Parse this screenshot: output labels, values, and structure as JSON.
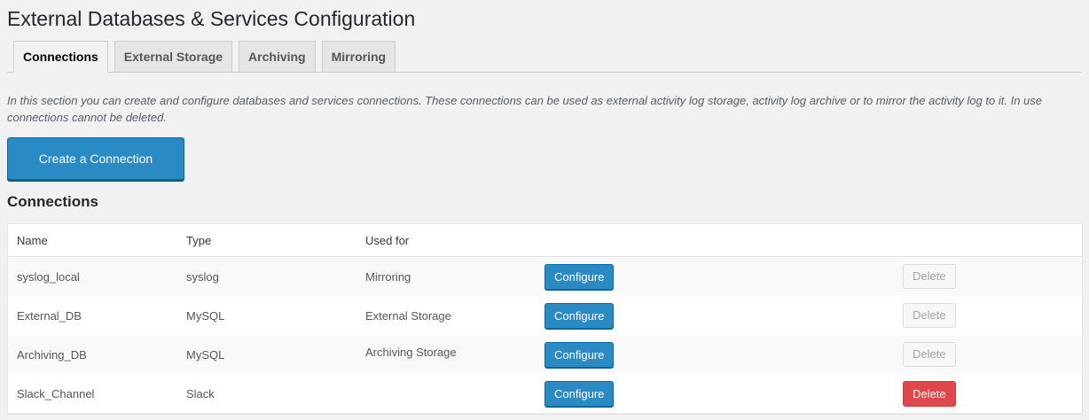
{
  "page": {
    "title": "External Databases & Services Configuration",
    "description": "In this section you can create and configure databases and services connections. These connections can be used as external activity log storage, activity log archive or to mirror the activity log to it. In use connections cannot be deleted."
  },
  "tabs": [
    {
      "label": "Connections",
      "active": true
    },
    {
      "label": "External Storage",
      "active": false
    },
    {
      "label": "Archiving",
      "active": false
    },
    {
      "label": "Mirroring",
      "active": false
    }
  ],
  "create_button": {
    "label": "Create a Connection"
  },
  "connections": {
    "title": "Connections",
    "columns": {
      "name": "Name",
      "type": "Type",
      "used_for": "Used for"
    },
    "rows": [
      {
        "name": "syslog_local",
        "type": "syslog",
        "used_for": "Mirroring",
        "configure": "Configure",
        "delete": "Delete",
        "delete_enabled": false
      },
      {
        "name": "External_DB",
        "type": "MySQL",
        "used_for": "External Storage",
        "configure": "Configure",
        "delete": "Delete",
        "delete_enabled": false
      },
      {
        "name": "Archiving_DB",
        "type": "MySQL",
        "used_for": "Archiving Storage",
        "configure": "Configure",
        "delete": "Delete",
        "delete_enabled": false
      },
      {
        "name": "Slack_Channel",
        "type": "Slack",
        "used_for": "",
        "configure": "Configure",
        "delete": "Delete",
        "delete_enabled": true
      }
    ]
  },
  "colors": {
    "primary": "#2a8ac4",
    "danger": "#e0474c",
    "background": "#f1f1f1"
  }
}
